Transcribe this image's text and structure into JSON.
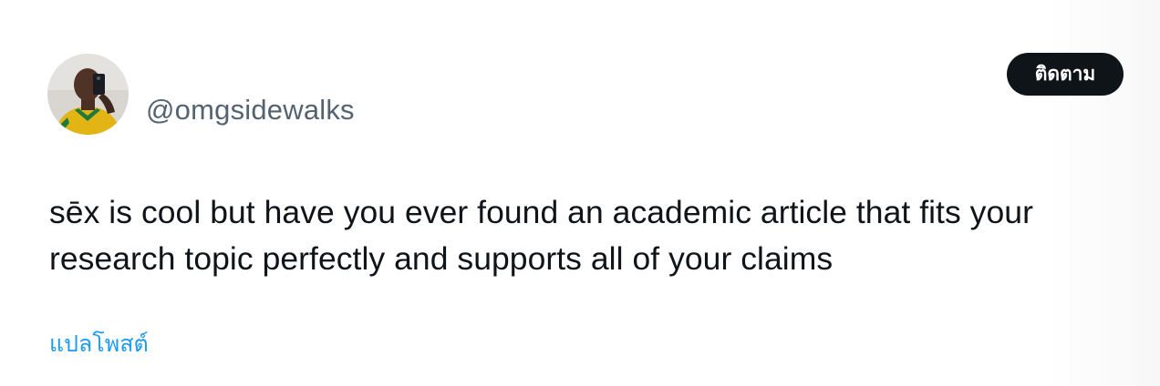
{
  "tweet": {
    "author": {
      "handle": "@omgsidewalks",
      "avatar_icon": "profile-photo"
    },
    "follow_label": "ติดตาม",
    "text": "sēx is cool but have you ever found an academic article that fits your research topic perfectly and supports all of your claims",
    "translate_label": "แปลโพสต์"
  },
  "colors": {
    "text_primary": "#0f1419",
    "text_secondary": "#536471",
    "link": "#1d9bf0",
    "button_bg": "#0f1419",
    "button_text": "#ffffff"
  }
}
